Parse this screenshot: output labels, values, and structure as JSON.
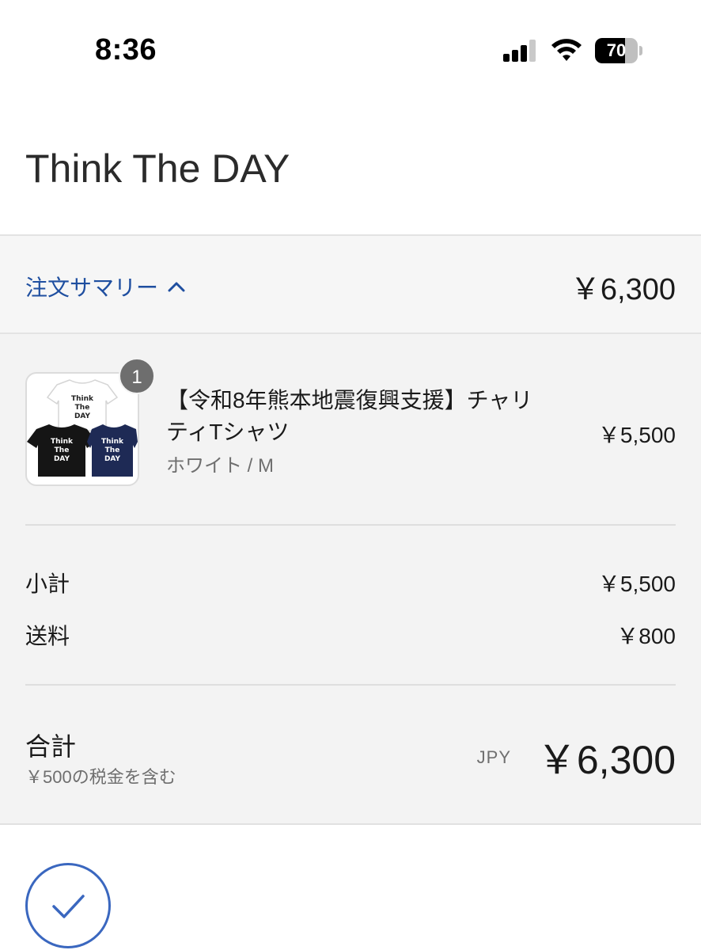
{
  "status_bar": {
    "time": "8:36",
    "battery_level": 70,
    "battery_text": "70",
    "signal_bars_active": 3,
    "signal_bars_total": 4
  },
  "shop": {
    "title": "Think The DAY"
  },
  "summary": {
    "toggle_label": "注文サマリー",
    "toggle_icon": "chevron-up-icon",
    "total": "￥6,300",
    "accent_color": "#1f4fa0"
  },
  "line_item": {
    "quantity": "1",
    "name": "【令和8年熊本地震復興支援】チャリティTシャツ",
    "variant": "ホワイト / M",
    "price": "￥5,500",
    "image_text": [
      "Think",
      "The",
      "DAY"
    ]
  },
  "costs": {
    "subtotal_label": "小計",
    "subtotal_value": "￥5,500",
    "shipping_label": "送料",
    "shipping_value": "￥800"
  },
  "total": {
    "label": "合計",
    "tax_note": "￥500の税金を含む",
    "currency": "JPY",
    "amount": "￥6,300"
  },
  "confirmation": {
    "icon": "checkmark-icon",
    "accent_color": "#3a67bf"
  }
}
